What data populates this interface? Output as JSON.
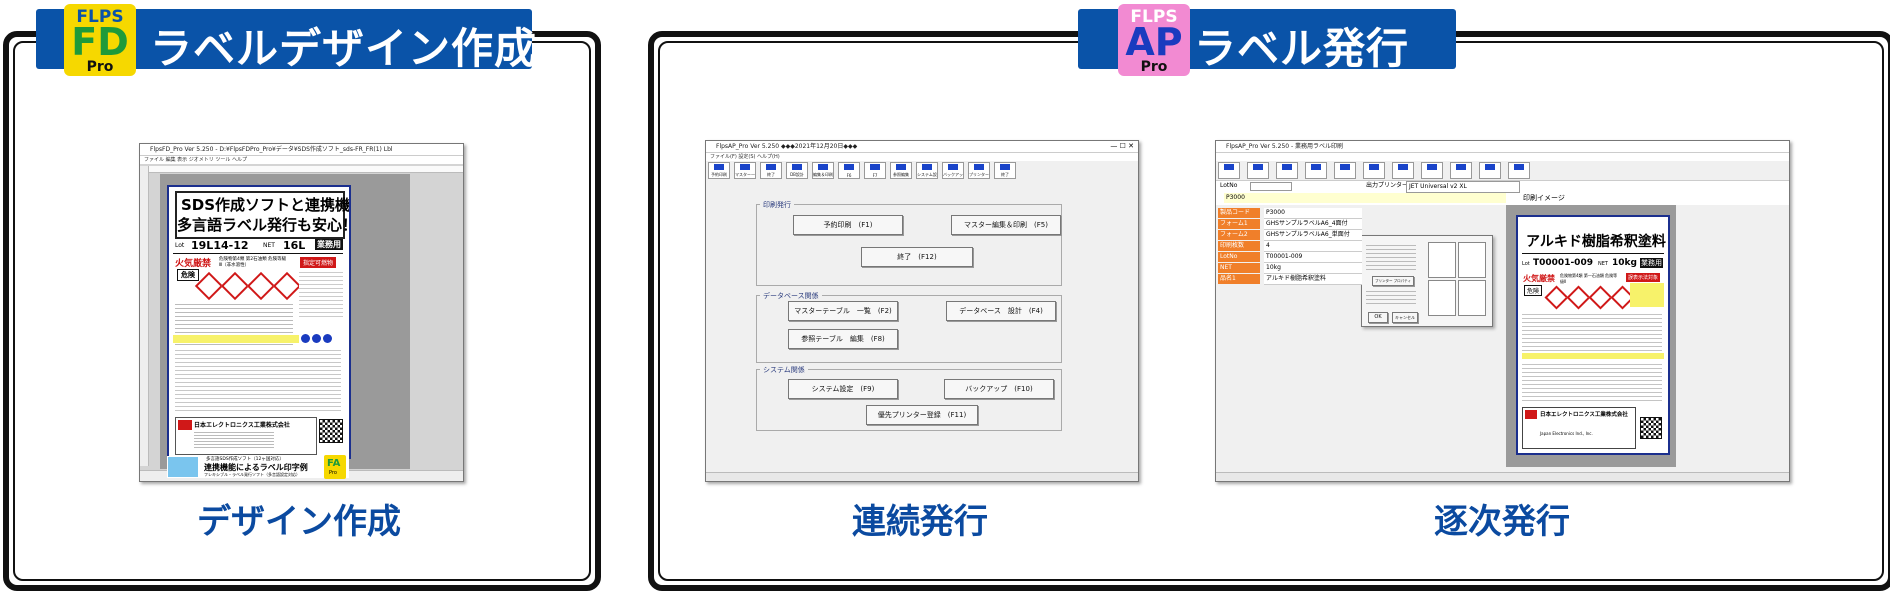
{
  "left_panel": {
    "banner_title": "ラベルデザイン作成",
    "logo": {
      "top": "FLPS",
      "main": "FD",
      "sub": "Pro",
      "color": "#f6d800",
      "main_color": "#1e9a3a"
    },
    "caption": "デザイン作成",
    "screenshot": {
      "window_title": "FlpsFD_Pro Ver 5.250 - D:¥FlpsFDPro_Pro¥データ¥SDS作成ソフト_sds-FR_FR(1) Lbl",
      "menu": "ファイル  編集  表示  ジオメトリ  ツール  ヘルプ",
      "label": {
        "headline1": "SDS作成ソフトと連携機能",
        "headline2": "多言語ラベル発行も安心！",
        "lot_label": "Lot",
        "lot_value": "19L14-12",
        "net_label": "NET",
        "net_value": "16L",
        "badge": "業務用",
        "hazard": "火気厳禁",
        "hazard_note": "危険物第4類 第2石油類 危険等級Ⅲ（非水溶性）",
        "danger": "危険",
        "red_box": "指定可燃物",
        "company": "日本エレクトロニクス工業株式会社",
        "footer_note": "多言語SDS作成ソフト（12ヶ国対応）",
        "footer_title": "連携機能によるラベル印字例",
        "footer_sub": "フレキシブル・ラベル発行ソフト（多言語設定対応）",
        "fa_logo": "FA",
        "fa_sub": "Pro"
      }
    }
  },
  "right_panel": {
    "banner_title": "ラベル発行",
    "logo": {
      "top": "FLPS",
      "main": "AP",
      "sub": "Pro",
      "color": "#f28ad2",
      "main_color": "#1a3bbf"
    },
    "captions": {
      "continuous": "連続発行",
      "sequential": "逐次発行"
    },
    "continuous_window": {
      "window_title": "FlpsAP_Pro Ver 5.250    ◆◆◆2021年12月20日◆◆◆",
      "menu": "ファイル(F)   設定(S)   ヘルプ(H)",
      "toolbar": [
        "予約印刷",
        "マスター一覧",
        "終了",
        "DB設計",
        "編集＆印刷",
        "F6",
        "F7",
        "参照編集",
        "システム設定",
        "バックアップ",
        "プリンター登録",
        "終了"
      ],
      "groups": {
        "print": "印刷発行",
        "database": "データベース関係",
        "system": "システム関係"
      },
      "buttons": {
        "reserve_print": "予約印刷　(F1)",
        "master_edit_print": "マスター編集＆印刷　(F5)",
        "exit": "終了　(F12)",
        "master_table_list": "マスターテーブル　一覧　(F2)",
        "database_design": "データベース　設計　(F4)",
        "ref_table_edit": "参照テーブル　編集　(F8)",
        "system_settings": "システム設定　(F9)",
        "backup": "バックアップ　(F10)",
        "priority_printer": "優先プリンター登録　(F11)"
      }
    },
    "sequential_window": {
      "window_title": "FlpsAP_Pro Ver 5.250 - 業務用ラベル印刷",
      "lotno_label": "LotNo",
      "output_printer": "出力プリンター",
      "printer_name": "JET Universal v2 XL",
      "print_image": "印刷イメージ",
      "search_value": "P3000",
      "fields": [
        {
          "label": "製品コード",
          "value": "P3000"
        },
        {
          "label": "フォーム1",
          "value": "GHSサンプルラベルA6_4面付"
        },
        {
          "label": "フォーム2",
          "value": "GHSサンプルラベルA6_単面付"
        },
        {
          "label": "印刷枚数",
          "value": "4"
        },
        {
          "label": "LotNo",
          "value": "T00001-009"
        },
        {
          "label": "NET",
          "value": "10kg"
        },
        {
          "label": "品名1",
          "value": "アルキド樹脂希釈塗料"
        }
      ],
      "dialog": {
        "ok": "OK",
        "cancel": "キャンセル",
        "printer_property": "プリンター プロパティ"
      },
      "label": {
        "title": "アルキド樹脂希釈塗料",
        "lot_label": "Lot",
        "lot_value": "T00001-009",
        "net_label": "NET",
        "net_value": "10kg",
        "badge": "業務用",
        "hazard": "火気厳禁",
        "hazard_note": "危険物第4類 第一石油類 危険等級Ⅱ",
        "danger": "危険",
        "red_box": "誤表示法対象",
        "company": "日本エレクトロニクス工業株式会社",
        "company_en": "Japan Electronics Ind., Inc."
      }
    }
  }
}
